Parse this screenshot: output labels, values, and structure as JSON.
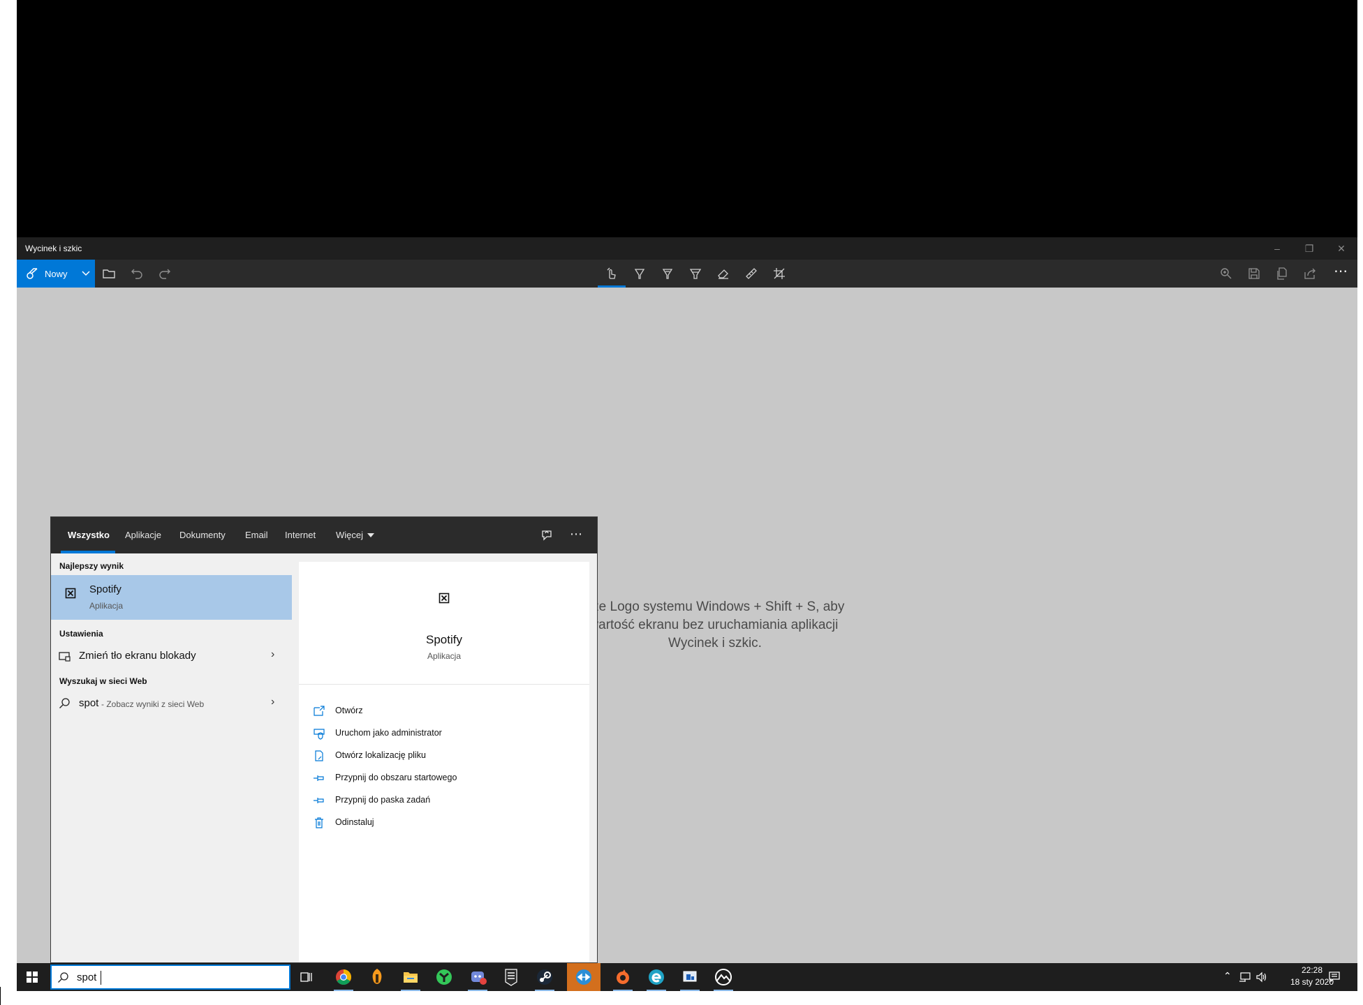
{
  "snip_window": {
    "title": "Wycinek i szkic",
    "new_label": "Nowy",
    "hint": "sze Logo systemu Windows + Shift + S, aby\nvartość ekranu bez uruchamiania aplikacji\nWycinek i szkic.",
    "icons": [
      "new-snip-icon",
      "chevron-down-icon",
      "open-folder-icon",
      "undo-icon",
      "redo-icon",
      "touch-writing-icon",
      "ballpoint-pen-icon",
      "pencil-icon",
      "highlighter-icon",
      "eraser-icon",
      "ruler-icon",
      "crop-icon",
      "zoom-icon",
      "save-icon",
      "copy-icon",
      "share-icon",
      "more-icon"
    ]
  },
  "search_panel": {
    "tabs": [
      {
        "label": "Wszystko",
        "active": true
      },
      {
        "label": "Aplikacje"
      },
      {
        "label": "Dokumenty"
      },
      {
        "label": "Email"
      },
      {
        "label": "Internet"
      },
      {
        "label": "Więcej"
      }
    ],
    "sections": {
      "best": "Najlepszy wynik",
      "settings": "Ustawienia",
      "web": "Wyszukaj w sieci Web"
    },
    "best_result": {
      "title": "Spotify",
      "subtitle": "Aplikacja"
    },
    "settings_item": "Zmień tło ekranu blokady",
    "web_item": {
      "term": "spot",
      "suffix": " - Zobacz wyniki z sieci Web"
    },
    "detail": {
      "title": "Spotify",
      "subtitle": "Aplikacja",
      "actions": [
        "Otwórz",
        "Uruchom jako administrator",
        "Otwórz lokalizację pliku",
        "Przypnij do obszaru startowego",
        "Przypnij do paska zadań",
        "Odinstaluj"
      ]
    }
  },
  "taskbar": {
    "search_value": "spot",
    "time": "22:28",
    "date": "18 sty 2020",
    "apps": [
      "chrome",
      "fl-studio",
      "file-explorer",
      "green-app",
      "discord-app",
      "epic-games",
      "steam",
      "teamviewer",
      "origin",
      "edge",
      "monitor-app",
      "sky-app"
    ],
    "accent": "#0078d7"
  }
}
